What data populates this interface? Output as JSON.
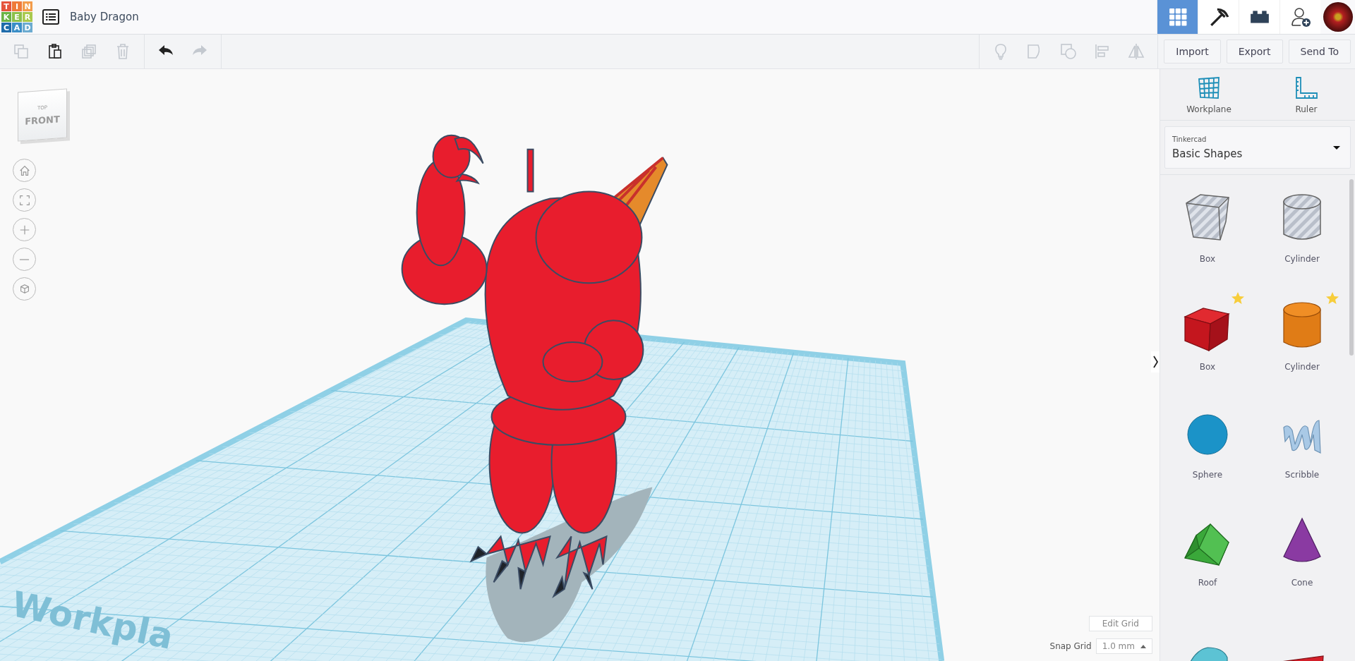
{
  "logo": {
    "letters": [
      {
        "text": "T",
        "color": "#e5543c"
      },
      {
        "text": "I",
        "color": "#ef7a3a"
      },
      {
        "text": "N",
        "color": "#f39c4b"
      },
      {
        "text": "K",
        "color": "#6bb345"
      },
      {
        "text": "E",
        "color": "#8cc04a"
      },
      {
        "text": "R",
        "color": "#a9c94d"
      },
      {
        "text": "C",
        "color": "#1f6cab"
      },
      {
        "text": "A",
        "color": "#3b8ec6"
      },
      {
        "text": "D",
        "color": "#6cabd0"
      }
    ]
  },
  "document": {
    "title": "Baby Dragon"
  },
  "nav": [
    {
      "kind": "grid",
      "selected": true
    },
    {
      "kind": "pickaxe",
      "selected": false
    },
    {
      "kind": "bricks",
      "selected": false
    },
    {
      "kind": "add-user",
      "selected": false
    }
  ],
  "toolbar": {
    "edit": [
      {
        "kind": "copy",
        "disabled": true
      },
      {
        "kind": "paste",
        "disabled": false
      },
      {
        "kind": "duplicate",
        "disabled": true
      },
      {
        "kind": "delete",
        "disabled": true
      }
    ],
    "history": [
      {
        "kind": "undo",
        "disabled": false
      },
      {
        "kind": "redo",
        "disabled": true
      }
    ],
    "tools": [
      {
        "kind": "note",
        "disabled": true
      },
      {
        "kind": "solid",
        "disabled": true
      },
      {
        "kind": "hole",
        "disabled": true
      },
      {
        "kind": "align",
        "disabled": true
      },
      {
        "kind": "mirror",
        "disabled": true
      }
    ],
    "buttons": [
      "Import",
      "Export",
      "Send To"
    ]
  },
  "view_cube": {
    "front": "FRONT",
    "top": "TOP"
  },
  "view_controls": [
    {
      "kind": "home"
    },
    {
      "kind": "fit"
    },
    {
      "kind": "zoom-in"
    },
    {
      "kind": "zoom-out"
    },
    {
      "kind": "perspective"
    }
  ],
  "workplane_label": "Workpla",
  "grid_controls": {
    "edit_button": "Edit Grid",
    "snap_label": "Snap Grid",
    "snap_value": "1.0 mm"
  },
  "panel": {
    "tools": [
      {
        "kind": "workplane",
        "label": "Workplane"
      },
      {
        "kind": "ruler",
        "label": "Ruler"
      }
    ],
    "library": {
      "caption": "Tinkercad",
      "value": "Basic Shapes"
    },
    "shapes": [
      {
        "kind": "box-hole",
        "label": "Box",
        "starred": false
      },
      {
        "kind": "cylinder-hole",
        "label": "Cylinder",
        "starred": false
      },
      {
        "kind": "box",
        "label": "Box",
        "starred": true
      },
      {
        "kind": "cylinder",
        "label": "Cylinder",
        "starred": true
      },
      {
        "kind": "sphere",
        "label": "Sphere",
        "starred": false
      },
      {
        "kind": "scribble",
        "label": "Scribble",
        "starred": false
      },
      {
        "kind": "roof",
        "label": "Roof",
        "starred": false
      },
      {
        "kind": "cone",
        "label": "Cone",
        "starred": false
      },
      {
        "kind": "half-cylinder",
        "starred": false
      },
      {
        "kind": "text-shape",
        "starred": false
      }
    ]
  }
}
